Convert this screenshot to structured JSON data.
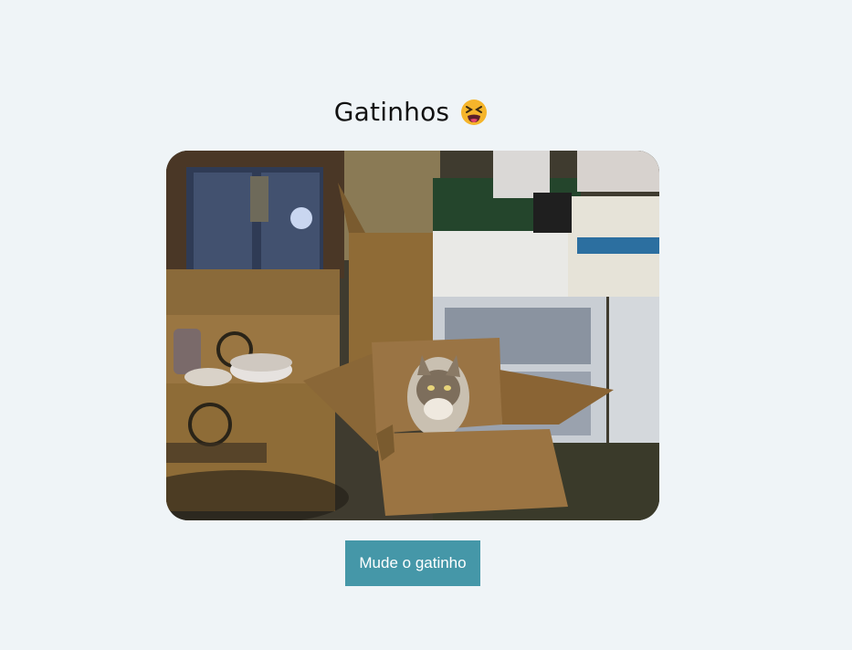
{
  "page": {
    "title": "Gatinhos",
    "title_emoji_icon": "tired-face-emoji-icon"
  },
  "photo": {
    "subject": "cat-in-cardboard-box-photo"
  },
  "actions": {
    "change_kitten_label": "Mude o gatinho"
  },
  "colors": {
    "background": "#eff4f7",
    "button": "#4597a8",
    "button_text": "#ffffff",
    "title_text": "#111111"
  }
}
